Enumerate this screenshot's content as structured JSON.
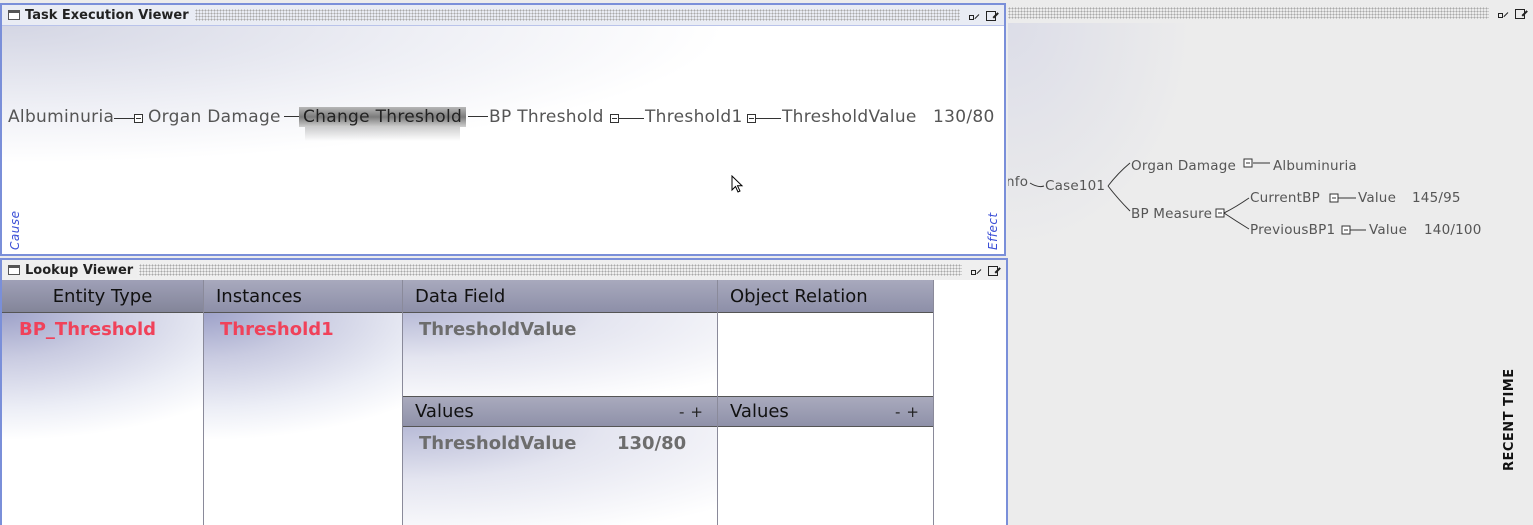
{
  "task_viewer": {
    "title": "Task Execution Viewer",
    "chain": {
      "n1": "Albuminuria",
      "n2": "Organ Damage",
      "n3": "Change Threshold",
      "n4": "BP Threshold",
      "n5": "Threshold1",
      "n6": "ThresholdValue",
      "n6_value": "130/80"
    },
    "left_label": "Cause",
    "right_label": "Effect"
  },
  "lookup_viewer": {
    "title": "Lookup Viewer",
    "columns": {
      "entity_type": "Entity Type",
      "instances": "Instances",
      "data_field": "Data Field",
      "object_relation": "Object Relation"
    },
    "entity_type_value": "BP_Threshold",
    "instance_value": "Threshold1",
    "data_field_value": "ThresholdValue",
    "values_header_1": "Values",
    "values_header_2": "Values",
    "minus": "-",
    "plus": "+",
    "values_row": {
      "field": "ThresholdValue",
      "value": "130/80"
    }
  },
  "right_panel": {
    "tree": {
      "root_partial": "nfo",
      "case": "Case101",
      "organ_damage": "Organ Damage",
      "albuminuria": "Albuminuria",
      "bp_measure": "BP Measure",
      "current_bp": "CurrentBP",
      "current_value_label": "Value",
      "current_value": "145/95",
      "previous_bp": "PreviousBP1",
      "previous_value_label": "Value",
      "previous_value": "140/100"
    },
    "time_label": "RECENT TIME"
  },
  "colors": {
    "frame_border": "#7a8fd9",
    "accent_red": "#f0425a",
    "label_blue": "#3b4fd6"
  }
}
